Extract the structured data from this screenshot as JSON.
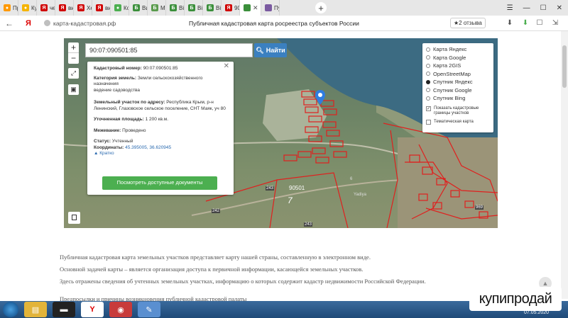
{
  "browser": {
    "tabs": [
      {
        "label": "Пр",
        "color": "#ff9900",
        "glyph": "●"
      },
      {
        "label": "Ку",
        "color": "#f5b400",
        "glyph": "●"
      },
      {
        "label": "че",
        "color": "#d00000",
        "glyph": "Я"
      },
      {
        "label": "ви",
        "color": "#d00000",
        "glyph": "Я"
      },
      {
        "label": "Хе",
        "color": "#d00000",
        "glyph": "Я"
      },
      {
        "label": "ви",
        "color": "#d00000",
        "glyph": "Я"
      },
      {
        "label": "Ко",
        "color": "#4caf50",
        "glyph": "●"
      },
      {
        "label": "Ви",
        "color": "#3b8f3b",
        "glyph": "Б"
      },
      {
        "label": "Мі",
        "color": "#5a9b4d",
        "glyph": "Б"
      },
      {
        "label": "Ві",
        "color": "#3b8f3b",
        "glyph": "Б"
      },
      {
        "label": "Ві",
        "color": "#3b8f3b",
        "glyph": "Б"
      },
      {
        "label": "Ві",
        "color": "#3b8f3b",
        "glyph": "Б"
      },
      {
        "label": "90",
        "color": "#d00000",
        "glyph": "Я"
      }
    ],
    "active_tab_close": "✕",
    "last_tab": {
      "label": "Пу",
      "color": "#7a5aa0"
    },
    "new_tab": "+",
    "window_controls": [
      "☰",
      "—",
      "☐",
      "✕"
    ],
    "back_arrow": "←",
    "ya_logo": "Я",
    "url": "карта-кадастровая.рф",
    "page_title": "Публичная кадастровая карта росреестра субъектов России",
    "reviews": "★2 отзыва"
  },
  "map": {
    "zoom_in": "+",
    "zoom_out": "−",
    "search_value": "90:07:090501:85",
    "search_button": "Найти",
    "info": {
      "cadastral_label": "Кадастровый номер:",
      "cadastral_value": "90:07:090501:85",
      "category_label": "Категория земель:",
      "category_value": "Земли сельскохозяйственного назначения",
      "category_extra": "ведение садоводства",
      "address_label": "Земельный участок по адресу:",
      "address_value": "Республика Крым, р-н Ленинский, Глазовское сельское поселение, СНТ Маяк, уч 80",
      "area_label": "Уточненная площадь:",
      "area_value": "1 200 кв.м.",
      "survey_label": "Межевание:",
      "survey_value": "Проведено",
      "status_label": "Статус:",
      "status_value": "Учтенный",
      "coords_label": "Координаты:",
      "coords_value": "45.395005, 36.620945",
      "brief_link": "▲ Кратко",
      "docs_button": "Посмотреть доступные документы",
      "close": "✕"
    },
    "layers": [
      {
        "label": "Карта Яндекс",
        "selected": false
      },
      {
        "label": "Карта Google",
        "selected": false
      },
      {
        "label": "Карта 2GIS",
        "selected": false
      },
      {
        "label": "OpenStreetMap",
        "selected": false
      },
      {
        "label": "Спутник Яндекс",
        "selected": true
      },
      {
        "label": "Спутник Google",
        "selected": false
      },
      {
        "label": "Спутник Bing",
        "selected": false
      }
    ],
    "checkboxes": [
      {
        "label": "Показать кадастровые границы участков",
        "checked": true
      },
      {
        "label": "Тематическая карта",
        "checked": false
      }
    ],
    "map_labels": [
      "90501",
      "7",
      "243",
      "242",
      "969",
      "243",
      "Yadiya",
      "6"
    ]
  },
  "article": {
    "p1": "Публичная кадастровая карта земельных участков представляет карту нашей страны, составленную в электронном виде.",
    "p2": "Основной задачей карты – является организация доступа к первичной информации, касающейся земельных участков.",
    "p3": "Здесь отражены сведения об учтенных земельных участках, информацию о которых содержит кадастр недвижимости Российской Федерации.",
    "heading": "Предпосылки и причины возникновения публичной кадастровой палаты"
  },
  "watermark": {
    "text": "купипродай",
    "date": "07.05.2020"
  }
}
